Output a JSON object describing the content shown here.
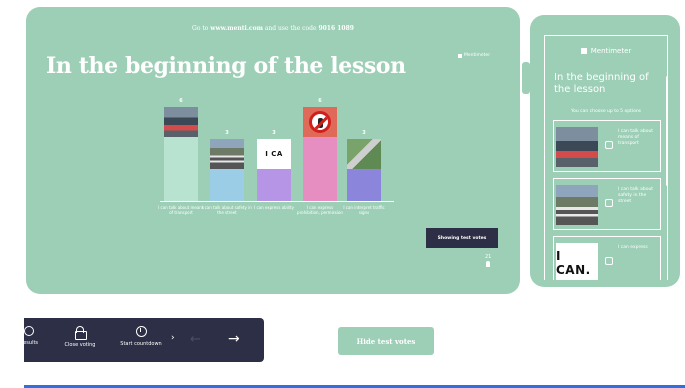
{
  "slide": {
    "join_prefix": "Go to ",
    "join_url": "www.menti.com",
    "join_mid": " and use the code ",
    "join_code": "9016 1089",
    "brand": "Mentimeter",
    "title": "In the beginning of the lesson",
    "bars": [
      {
        "count": "6",
        "votes": 6,
        "label": "I can talk about means of transport"
      },
      {
        "count": "3",
        "votes": 3,
        "label": "I can talk about safety in the street"
      },
      {
        "count": "3",
        "votes": 3,
        "label": "I can express ability"
      },
      {
        "count": "6",
        "votes": 6,
        "label": "I can express prohibition, permission"
      },
      {
        "count": "3",
        "votes": 3,
        "label": "I can interpret traffic signs"
      }
    ],
    "bar_colors": [
      "#b9e3d1",
      "#9ccde6",
      "#b695e6",
      "#e68ec1",
      "#8b85dc"
    ],
    "thumb_ican_text": "I CA",
    "show_test_votes": "Showing test votes",
    "vote_count": "21"
  },
  "phone": {
    "brand": "Mentimeter",
    "title": "In the beginning of the lesson",
    "hint": "You can choose up to 5 options",
    "options": [
      {
        "label": "I can talk about means of transport"
      },
      {
        "label": "I can talk about safety in the street"
      },
      {
        "label": "I can express",
        "image_text": "I CAN."
      }
    ]
  },
  "toolbar": {
    "results": "Results",
    "close_voting": "Close voting",
    "start_countdown": "Start countdown",
    "chevron": "›",
    "prev": "←",
    "next": "→"
  },
  "hide_test_votes": "Hide test votes",
  "colors": {
    "slide_bg": "#9ccfb6",
    "dark": "#2c2f45",
    "accent_line": "#2f6fe0"
  }
}
